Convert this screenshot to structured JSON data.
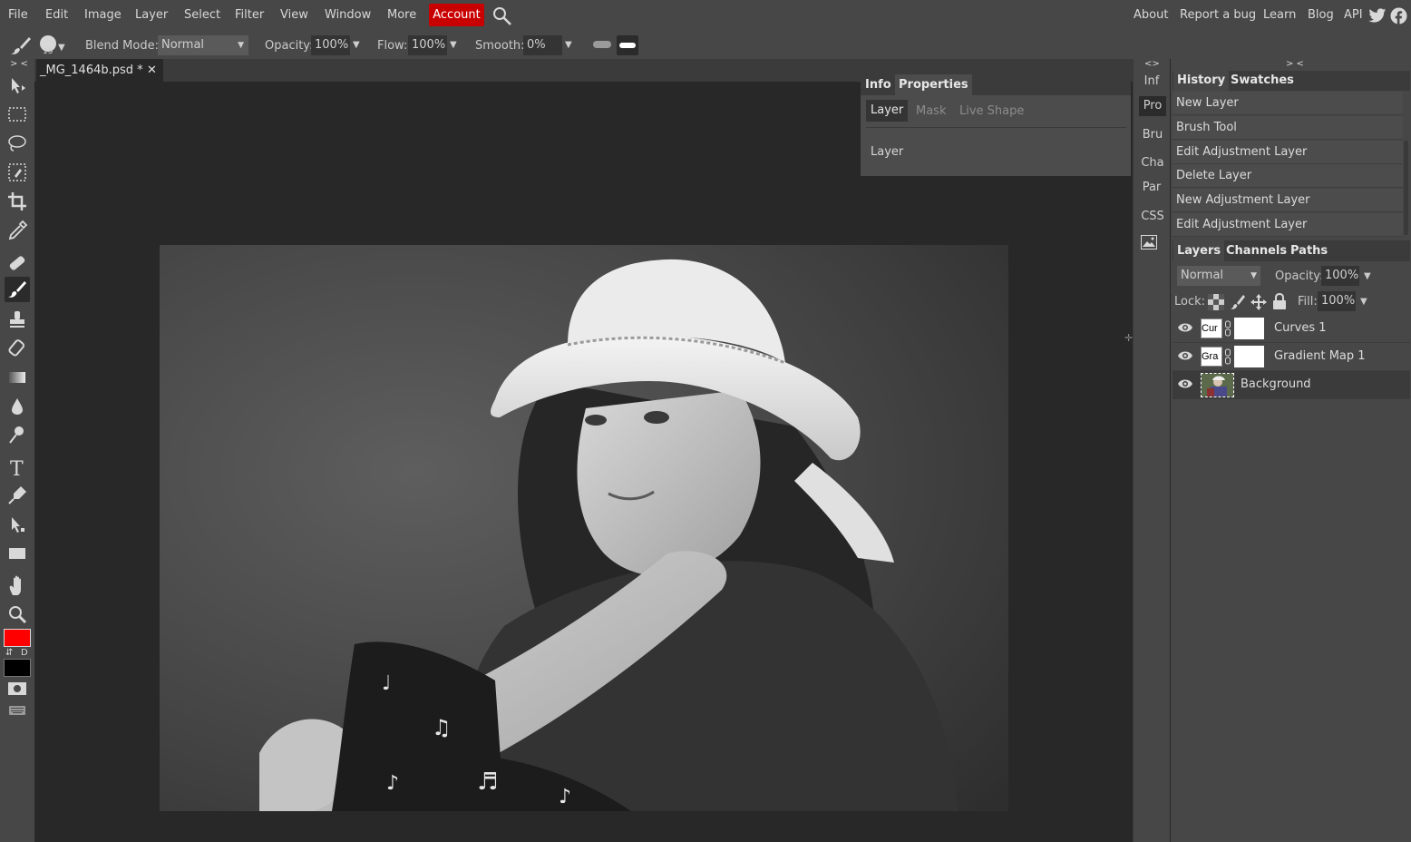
{
  "menu": {
    "items": [
      "File",
      "Edit",
      "Image",
      "Layer",
      "Select",
      "Filter",
      "View",
      "Window",
      "More"
    ],
    "account": "Account",
    "right": [
      "About",
      "Report a bug",
      "Learn",
      "Blog",
      "API"
    ]
  },
  "options": {
    "brush_size": "15",
    "blend_label": "Blend Mode:",
    "blend_value": "Normal",
    "opacity_label": "Opacity:",
    "opacity_value": "100%",
    "flow_label": "Flow:",
    "flow_value": "100%",
    "smooth_label": "Smooth:",
    "smooth_value": "0%"
  },
  "toolbar": {
    "collapse": "> <",
    "swap_label": "D"
  },
  "document": {
    "tab_title": "_MG_1464b.psd *",
    "close": "✕"
  },
  "info_panel": {
    "tabs": [
      "Info",
      "Properties"
    ],
    "subtabs": [
      "Layer",
      "Mask",
      "Live Shape"
    ],
    "content": "Layer"
  },
  "mid_strip": {
    "collapse": "<>",
    "items": [
      "Inf",
      "Pro",
      "Bru",
      "Cha",
      "Par",
      "CSS"
    ]
  },
  "history": {
    "collapse": "> <",
    "tabs": [
      "History",
      "Swatches"
    ],
    "items": [
      "New Layer",
      "Brush Tool",
      "Edit Adjustment Layer",
      "Delete Layer",
      "New Adjustment Layer",
      "Edit Adjustment Layer"
    ]
  },
  "layers": {
    "tabs": [
      "Layers",
      "Channels",
      "Paths"
    ],
    "blend": "Normal",
    "opacity_label": "Opacity:",
    "opacity_value": "100%",
    "lock_label": "Lock:",
    "fill_label": "Fill:",
    "fill_value": "100%",
    "rows": [
      {
        "thumb": "Cur",
        "name": "Curves 1"
      },
      {
        "thumb": "Gra",
        "name": "Gradient Map 1"
      },
      {
        "thumb": "",
        "name": "Background"
      }
    ]
  },
  "colors": {
    "foreground": "#ff0000",
    "background": "#000000",
    "accent": "#c90000"
  }
}
